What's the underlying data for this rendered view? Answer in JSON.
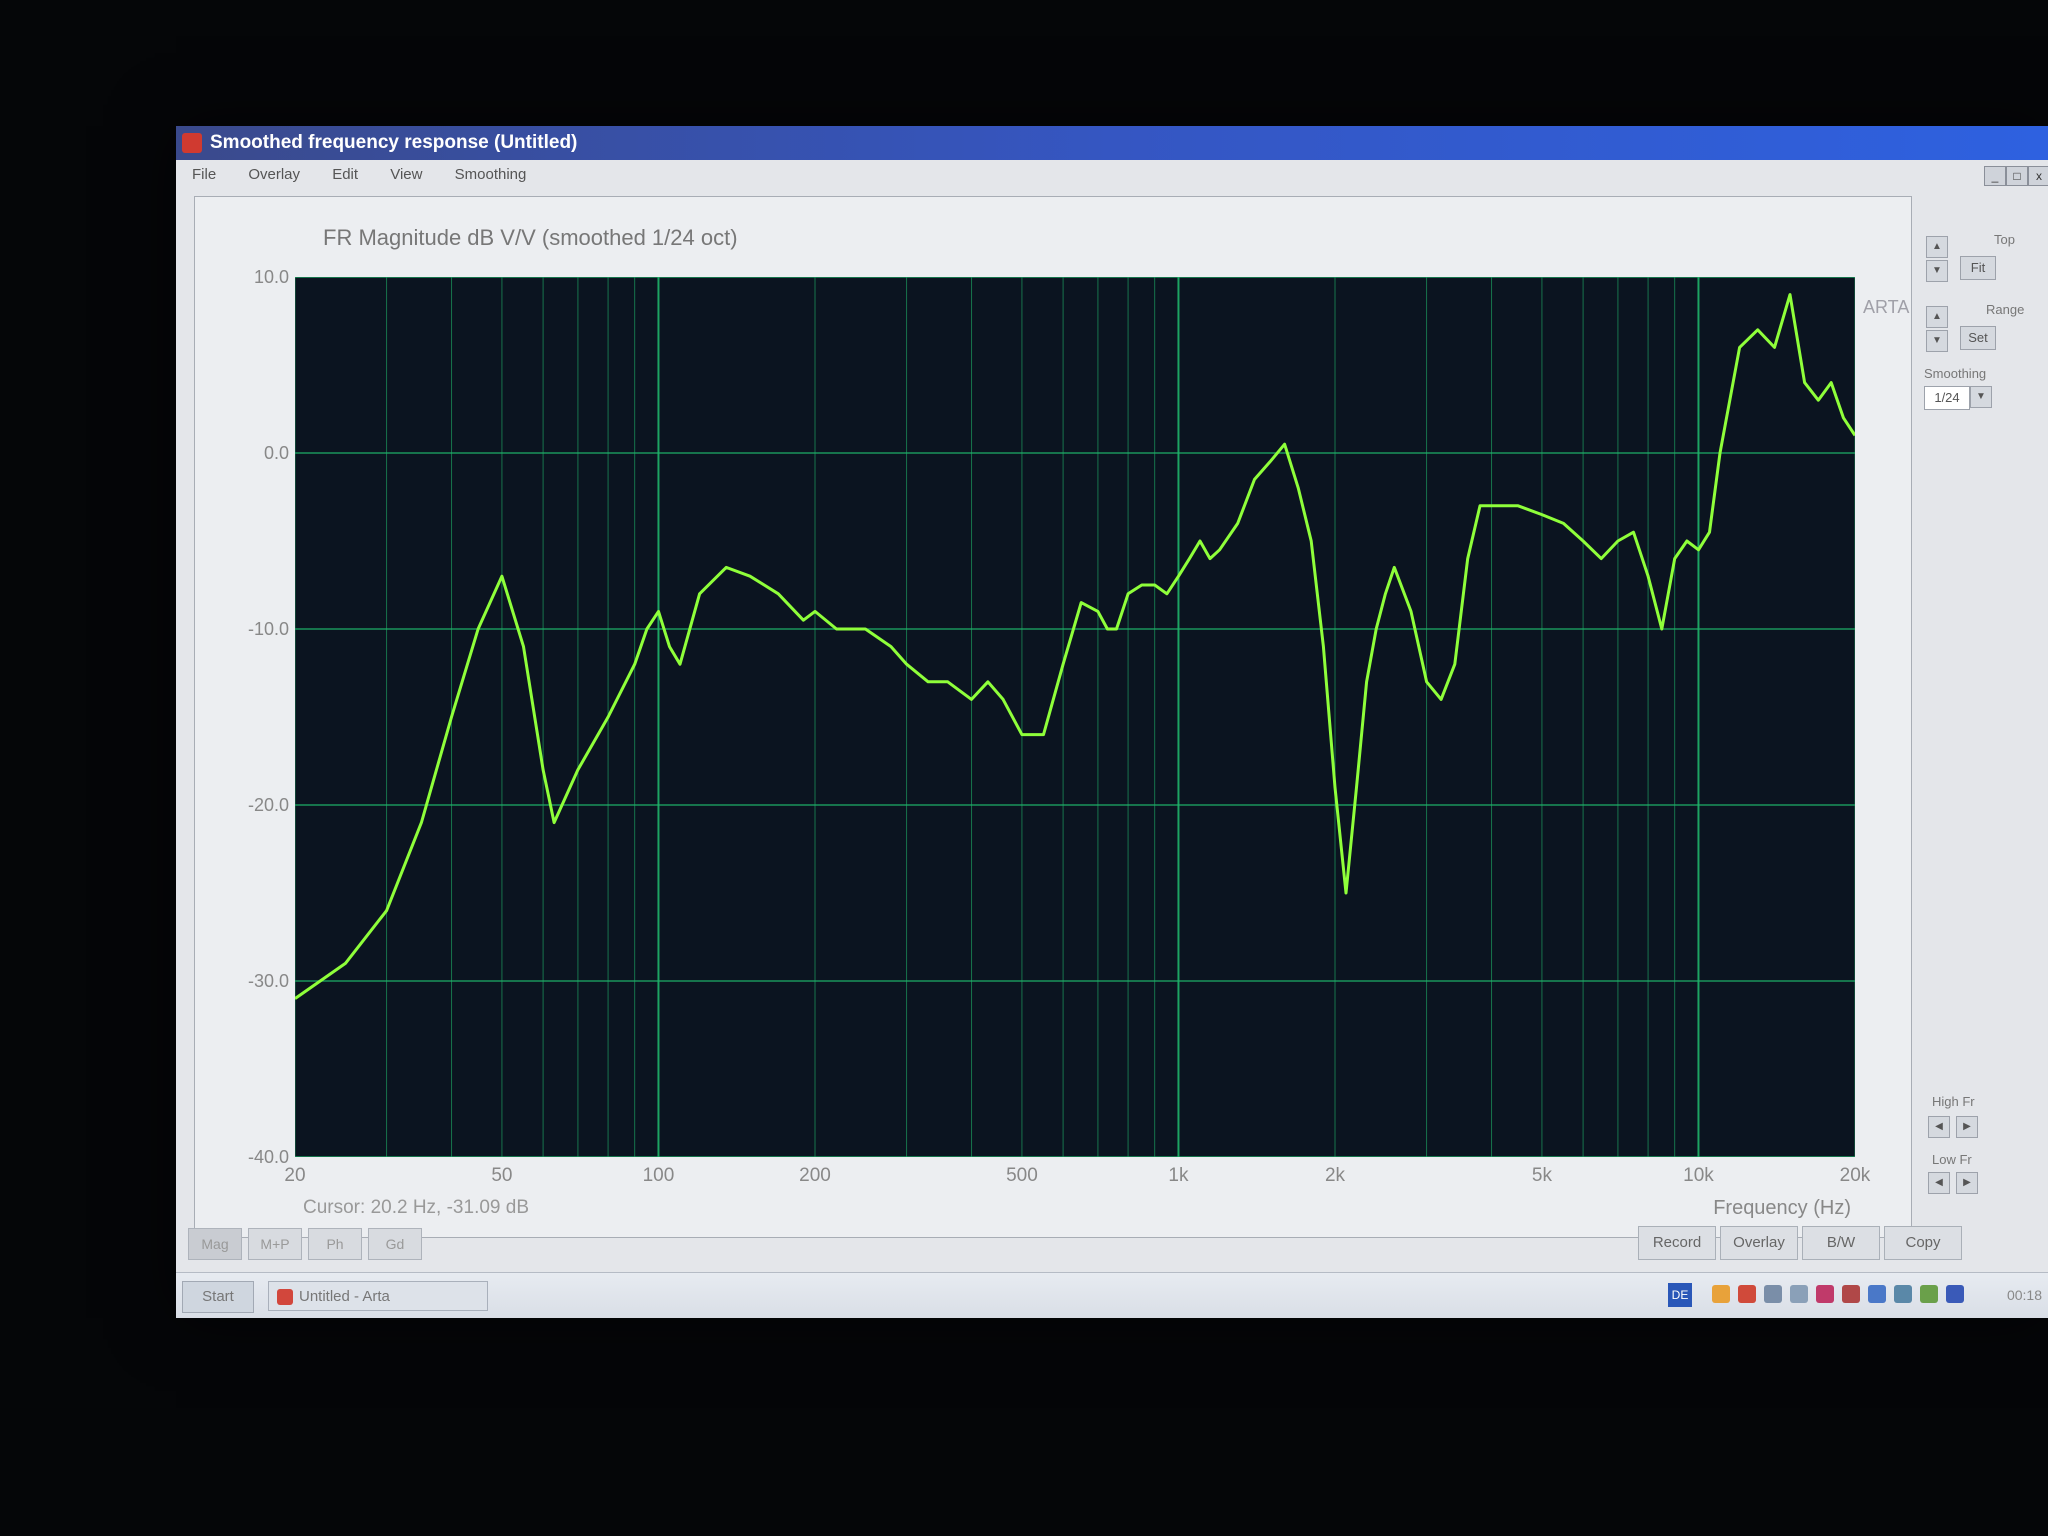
{
  "window": {
    "title": "Smoothed frequency response (Untitled)",
    "menu": [
      "File",
      "Overlay",
      "Edit",
      "View",
      "Smoothing"
    ]
  },
  "plot": {
    "title": "FR Magnitude dB V/V (smoothed 1/24 oct)",
    "y_ticks": [
      "10.0",
      "0.0",
      "-10.0",
      "-20.0",
      "-30.0",
      "-40.0"
    ],
    "x_ticks": [
      "20",
      "50",
      "100",
      "200",
      "500",
      "1k",
      "2k",
      "5k",
      "10k",
      "20k"
    ],
    "x_title": "Frequency (Hz)",
    "cursor": "Cursor: 20.2 Hz, -31.09 dB",
    "watermark": "ARTA"
  },
  "chart_data": {
    "type": "line",
    "title": "FR Magnitude dB V/V (smoothed 1/24 oct)",
    "xlabel": "Frequency (Hz)",
    "ylabel": "",
    "x_scale": "log",
    "xlim": [
      20,
      20000
    ],
    "ylim": [
      -40,
      10
    ],
    "grid": true,
    "line_color": "#8fff3a",
    "background_color": "#0b1420",
    "grid_color": "#1fb36a",
    "series": [
      {
        "x": [
          20,
          25,
          30,
          35,
          40,
          45,
          50,
          55,
          60,
          63,
          70,
          80,
          90,
          95,
          100,
          105,
          110,
          120,
          135,
          150,
          170,
          190,
          200,
          220,
          250,
          280,
          300,
          330,
          360,
          400,
          430,
          460,
          500,
          550,
          600,
          650,
          700,
          730,
          760,
          800,
          850,
          900,
          950,
          1000,
          1050,
          1100,
          1150,
          1200,
          1300,
          1400,
          1500,
          1600,
          1700,
          1800,
          1900,
          2000,
          2100,
          2200,
          2300,
          2400,
          2500,
          2600,
          2800,
          3000,
          3200,
          3400,
          3600,
          3800,
          4000,
          4200,
          4500,
          5000,
          5500,
          6000,
          6500,
          7000,
          7500,
          8000,
          8500,
          9000,
          9500,
          10000,
          10500,
          11000,
          12000,
          13000,
          14000,
          15000,
          16000,
          17000,
          18000,
          19000,
          20000
        ],
        "y": [
          -31,
          -29,
          -26,
          -21,
          -15,
          -10,
          -7,
          -11,
          -18,
          -21,
          -18,
          -15,
          -12,
          -10,
          -9,
          -11,
          -12,
          -8,
          -6.5,
          -7,
          -8,
          -9.5,
          -9,
          -10,
          -10,
          -11,
          -12,
          -13,
          -13,
          -14,
          -13,
          -14,
          -16,
          -16,
          -12,
          -8.5,
          -9,
          -10,
          -10,
          -8,
          -7.5,
          -7.5,
          -8,
          -7,
          -6,
          -5,
          -6,
          -5.5,
          -4,
          -1.5,
          -0.5,
          0.5,
          -2,
          -5,
          -11,
          -19,
          -25,
          -19,
          -13,
          -10,
          -8,
          -6.5,
          -9,
          -13,
          -14,
          -12,
          -6,
          -3,
          -3,
          -3,
          -3,
          -3.5,
          -4,
          -5,
          -6,
          -5,
          -4.5,
          -7,
          -10,
          -6,
          -5,
          -5.5,
          -4.5,
          0,
          6,
          7,
          6,
          9,
          4,
          3,
          4,
          2,
          1
        ]
      }
    ]
  },
  "right_panel": {
    "top_label": "Top",
    "fit_label": "Fit",
    "range_label": "Range",
    "set_label": "Set",
    "smoothing_label": "Smoothing",
    "smoothing_value": "1/24",
    "high_fr_label": "High Fr",
    "low_fr_label": "Low Fr"
  },
  "tabs": [
    "Mag",
    "M+P",
    "Ph",
    "Gd"
  ],
  "actions": [
    "Record",
    "Overlay",
    "B/W",
    "Copy"
  ],
  "taskbar": {
    "start": "Start",
    "item": "Untitled - Arta",
    "lang": "DE",
    "clock": "00:18"
  }
}
